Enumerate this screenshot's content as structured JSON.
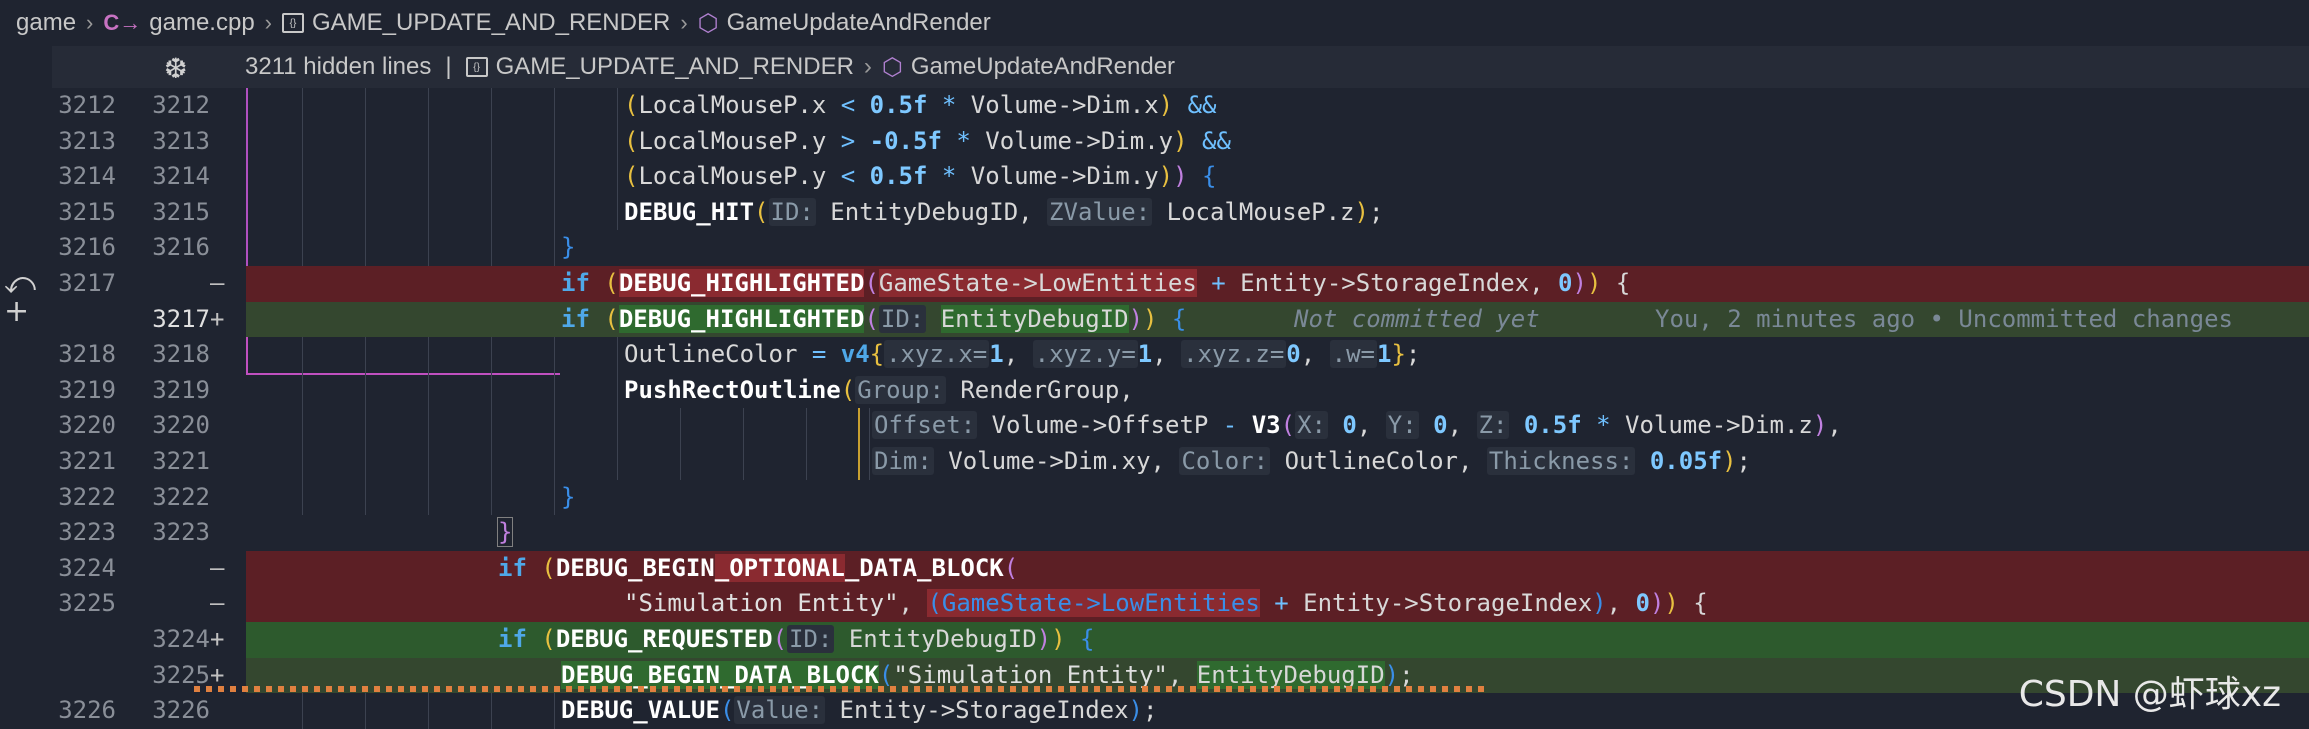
{
  "breadcrumb": {
    "folder": "game",
    "file": "game.cpp",
    "file_icon": "C→",
    "namespace": "GAME_UPDATE_AND_RENDER",
    "function": "GameUpdateAndRender"
  },
  "hidden_bar": {
    "count_text": "3211 hidden lines",
    "separator": "|",
    "namespace": "GAME_UPDATE_AND_RENDER",
    "function": "GameUpdateAndRender"
  },
  "lines": [
    {
      "old": "3212",
      "new": "3212",
      "marker": ""
    },
    {
      "old": "3213",
      "new": "3213",
      "marker": ""
    },
    {
      "old": "3214",
      "new": "3214",
      "marker": ""
    },
    {
      "old": "3215",
      "new": "3215",
      "marker": ""
    },
    {
      "old": "3216",
      "new": "3216",
      "marker": ""
    },
    {
      "old": "3217",
      "new": "",
      "marker": "—"
    },
    {
      "old": "",
      "new": "3217",
      "marker": "+"
    },
    {
      "old": "3218",
      "new": "3218",
      "marker": ""
    },
    {
      "old": "3219",
      "new": "3219",
      "marker": ""
    },
    {
      "old": "3220",
      "new": "3220",
      "marker": ""
    },
    {
      "old": "3221",
      "new": "3221",
      "marker": ""
    },
    {
      "old": "3222",
      "new": "3222",
      "marker": ""
    },
    {
      "old": "3223",
      "new": "3223",
      "marker": ""
    },
    {
      "old": "3224",
      "new": "",
      "marker": "—"
    },
    {
      "old": "3225",
      "new": "",
      "marker": "—"
    },
    {
      "old": "",
      "new": "3224",
      "marker": "+"
    },
    {
      "old": "",
      "new": "3225",
      "marker": "+"
    },
    {
      "old": "3226",
      "new": "3226",
      "marker": ""
    }
  ],
  "ghost_text": {
    "not_committed": "Not committed yet",
    "blame": "You, 2 minutes ago • Uncommitted changes"
  },
  "watermark": "CSDN @虾球xz"
}
